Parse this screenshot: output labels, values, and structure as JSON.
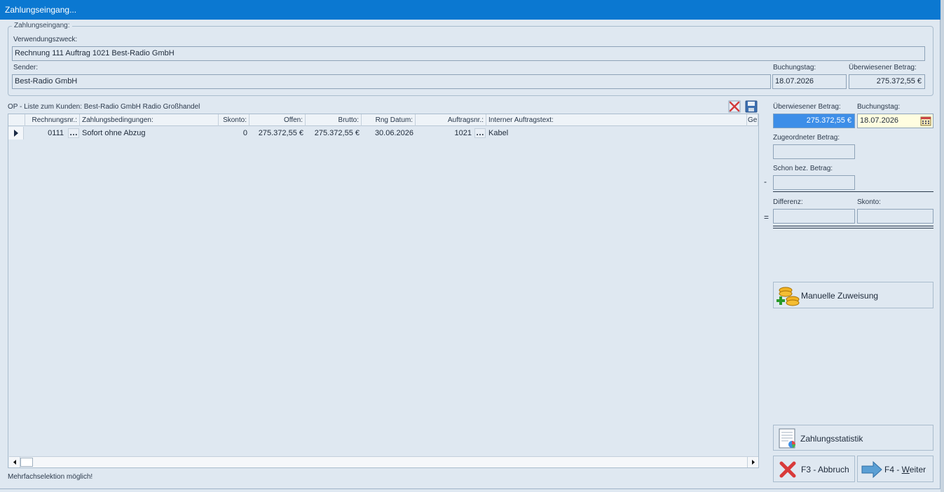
{
  "window": {
    "title": "Zahlungseingang..."
  },
  "group": {
    "legend": "Zahlungseingang:",
    "purpose_label": "Verwendungszweck:",
    "purpose_value": "Rechnung 111 Auftrag 1021 Best-Radio GmbH",
    "sender_label": "Sender:",
    "sender_value": "Best-Radio GmbH",
    "booking_day_label": "Buchungstag:",
    "booking_day_value": "18.07.2026",
    "transferred_label": "Überwiesener Betrag:",
    "transferred_value": "275.372,55 €"
  },
  "op_list": {
    "caption": "OP - Liste zum Kunden: Best-Radio GmbH Radio Großhandel",
    "columns": [
      "Rechnungsnr.:",
      "Zahlungsbedingungen:",
      "Skonto:",
      "Offen:",
      "Brutto:",
      "Rng Datum:",
      "Auftragsnr.:",
      "Interner Auftragstext:",
      "Ge"
    ],
    "rows": [
      {
        "invoice": "0111",
        "terms": "Sofort ohne Abzug",
        "skonto": "0",
        "open": "275.372,55 €",
        "gross": "275.372,55 €",
        "date": "30.06.2026",
        "order": "1021",
        "text": "Kabel"
      }
    ],
    "footer": "Mehrfachselektion möglich!",
    "delete_icon": "delete-x-icon",
    "save_icon": "floppy-disk-icon"
  },
  "side": {
    "transferred_label": "Überwiesener Betrag:",
    "transferred_value": "275.372,55 €",
    "booking_label": "Buchungstag:",
    "booking_value": "18.07.2026",
    "assigned_label": "Zugeordneter Betrag:",
    "assigned_value": "",
    "paid_label": "Schon bez. Betrag:",
    "paid_value": "",
    "minus_sign": "-",
    "difference_label": "Differenz:",
    "difference_value": "",
    "skonto_label": "Skonto:",
    "skonto_value": "",
    "equals_sign": "=",
    "manual_button": "Manuelle Zuweisung",
    "stats_button": "Zahlungsstatistik",
    "cancel_button": "F3 - Abbruch",
    "next_button_prefix": "F4 - ",
    "next_button_key": "W",
    "next_button_rest": "eiter"
  },
  "colors": {
    "titlebar": "#0b78d1",
    "background": "#dfe8f1",
    "selection": "#3d8ee8",
    "date_bg": "#fffde0"
  }
}
